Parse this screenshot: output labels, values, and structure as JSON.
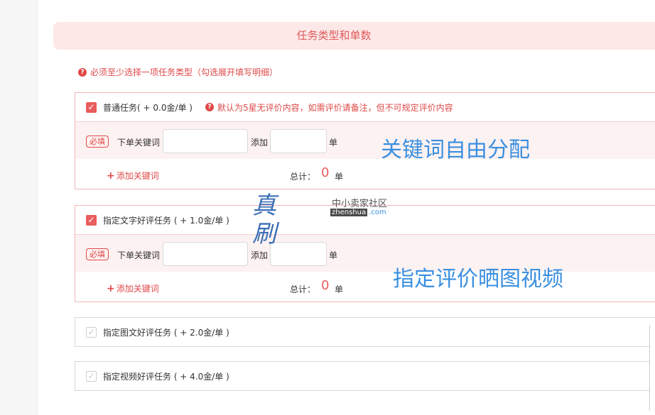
{
  "header": {
    "title": "任务类型和单数"
  },
  "warning": {
    "icon": "question-icon",
    "text": "必须至少选择一项任务类型（勾选展开填写明细）"
  },
  "tasks": [
    {
      "title": "普通任务( + 0.0金/单 )",
      "checked": true,
      "note": "默认为5星无评价内容，如需评价请备注，但不可规定评价内容",
      "required_tag": "必填",
      "keyword_label": "下单关键词",
      "keyword_value": "",
      "add_label": "添加",
      "count_value": "",
      "unit": "单",
      "add_keyword": "添加关键词",
      "total_label": "总计：",
      "total_value": "0",
      "total_unit": "单"
    },
    {
      "title": "指定文字好评任务 ( + 1.0金/单 )",
      "checked": true,
      "required_tag": "必填",
      "keyword_label": "下单关键词",
      "keyword_value": "",
      "add_label": "添加",
      "count_value": "",
      "unit": "单",
      "add_keyword": "添加关键词",
      "total_label": "总计：",
      "total_value": "0",
      "total_unit": "单"
    },
    {
      "title": "指定图文好评任务 ( + 2.0金/单 )",
      "checked": false
    },
    {
      "title": "指定视频好评任务 ( + 4.0金/单 )",
      "checked": false
    }
  ],
  "annotations": {
    "first": "关键词自由分配",
    "second": "指定评价晒图视频"
  },
  "watermark": {
    "main": "真刷",
    "sub_cn": "中小卖家社区",
    "sub_tag": "zhenshua",
    "sub_domain": ".com"
  },
  "colors": {
    "accent": "#e85d5d",
    "annotation": "#3a8fe0",
    "header_bg": "#fde8e8"
  }
}
